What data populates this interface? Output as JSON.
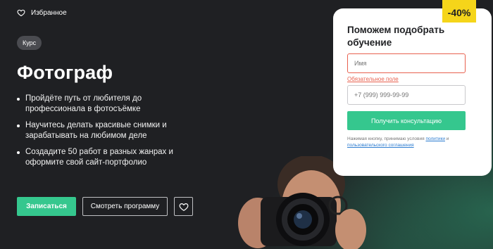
{
  "header": {
    "favorites_label": "Избранное"
  },
  "hero": {
    "badge": "Курс",
    "title": "Фотограф",
    "bullets": [
      "Пройдёте путь от любителя до профессионала в фотосъёмке",
      "Научитесь делать красивые снимки и зарабатывать на любимом деле",
      "Создадите 50 работ в разных жанрах и оформите свой сайт-портфолио"
    ],
    "enroll_label": "Записаться",
    "program_label": "Смотреть программу"
  },
  "form": {
    "discount": "-40%",
    "title": "Поможем подобрать обучение",
    "name_placeholder": "Имя",
    "name_error": "Обязательное поле",
    "phone_placeholder": "+7 (999) 999-99-99",
    "submit_label": "Получить консультацию",
    "consent_prefix": "Нажимая кнопку, принимаю условия",
    "consent_link1": "политики",
    "consent_and": "и",
    "consent_link2": "пользовательского соглашения"
  },
  "colors": {
    "background": "#1f2023",
    "accent": "#35c78e",
    "error": "#e8614f",
    "discount": "#f5d51a"
  }
}
